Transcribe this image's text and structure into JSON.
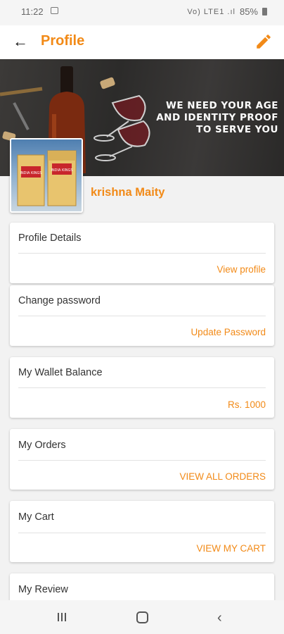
{
  "status": {
    "time": "11:22",
    "battery": "85%",
    "signal": "Vo) LTE1 .ıl",
    "gallery_icon": "image-icon"
  },
  "appbar": {
    "title": "Profile",
    "back_icon": "arrow-left-icon",
    "edit_icon": "pencil-icon"
  },
  "banner": {
    "lines": [
      "WE NEED YOUR AGE",
      "AND IDENTITY PROOF",
      "TO SERVE YOU"
    ],
    "brand_text": "INDIA KINGS"
  },
  "user": {
    "name": "krishna Maity"
  },
  "cards": [
    {
      "label": "Profile Details",
      "action": "View profile"
    },
    {
      "label": "Change password",
      "action": "Update Password"
    },
    {
      "label": "My Wallet Balance",
      "action": "Rs. 1000"
    },
    {
      "label": "My Orders",
      "action": "VIEW ALL ORDERS"
    },
    {
      "label": "My Cart",
      "action": "VIEW MY CART"
    },
    {
      "label": "My Review",
      "action": ""
    }
  ],
  "colors": {
    "accent": "#f28a17",
    "appbar_bg": "#ffffff",
    "page_bg": "#f2f2f2"
  },
  "navbar": {
    "recents_icon": "recents-icon",
    "home_icon": "home-icon",
    "back_icon": "back-chevron-icon"
  }
}
